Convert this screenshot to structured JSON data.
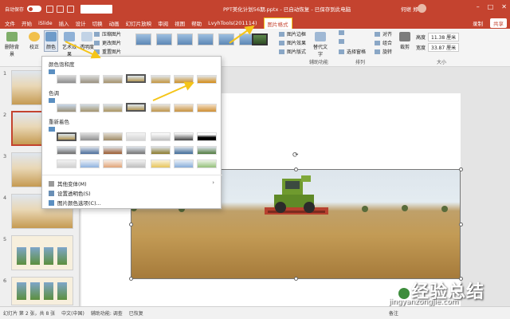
{
  "titlebar": {
    "autosave_label": "自动保存",
    "autosave_state": "关",
    "document_title": "PPT美化计划56期.pptx - 已自动恢复 - 已保存到此电脑",
    "user_name": "何继 郑",
    "accent": "#c4432f"
  },
  "tabs": [
    "文件",
    "开始",
    "iSlide",
    "插入",
    "设计",
    "切换",
    "动画",
    "幻灯片放映",
    "审阅",
    "视图",
    "帮助",
    "LvyhTools(201114)",
    "图片格式"
  ],
  "active_tab": "图片格式",
  "tab_right": {
    "record": "录制",
    "share": "共享"
  },
  "ribbon": {
    "remove_bg": "删除背景",
    "corrections": "校正",
    "color": "颜色",
    "artistic": "艺术效果",
    "transparency": "透明度",
    "compress": "压缩图片",
    "change": "更改图片",
    "reset": "重置图片",
    "border": "图片边框",
    "effects": "图片效果",
    "layout": "图片版式",
    "alt_text": "替代文字",
    "alt_text_group": "辅助功能",
    "selection_pane": "选择窗格",
    "align": "对齐",
    "group": "组合",
    "rotate": "旋转",
    "arrange_group": "排列",
    "crop": "裁剪",
    "height_label": "高度",
    "height": "11.38 厘米",
    "width_label": "宽度",
    "width": "33.87 厘米",
    "size_group": "大小"
  },
  "color_menu": {
    "saturation_header": "颜色饱和度",
    "tone_header": "色调",
    "recolor_header": "重新着色",
    "more_variations": "其他变体(M)",
    "set_transparent": "设置透明色(S)",
    "picture_color_options": "图片颜色选项(C)..."
  },
  "slides": [
    "1",
    "2",
    "3",
    "4",
    "5",
    "6"
  ],
  "status": {
    "slide_info": "幻灯片 第 2 张，共 8 张",
    "language": "中文(中国)",
    "accessibility": "辅助功能: 调查",
    "recovered": "已恢复",
    "notes": "备注"
  },
  "watermark": {
    "text": "经验总结",
    "url": "jingyanzongjie.com"
  }
}
